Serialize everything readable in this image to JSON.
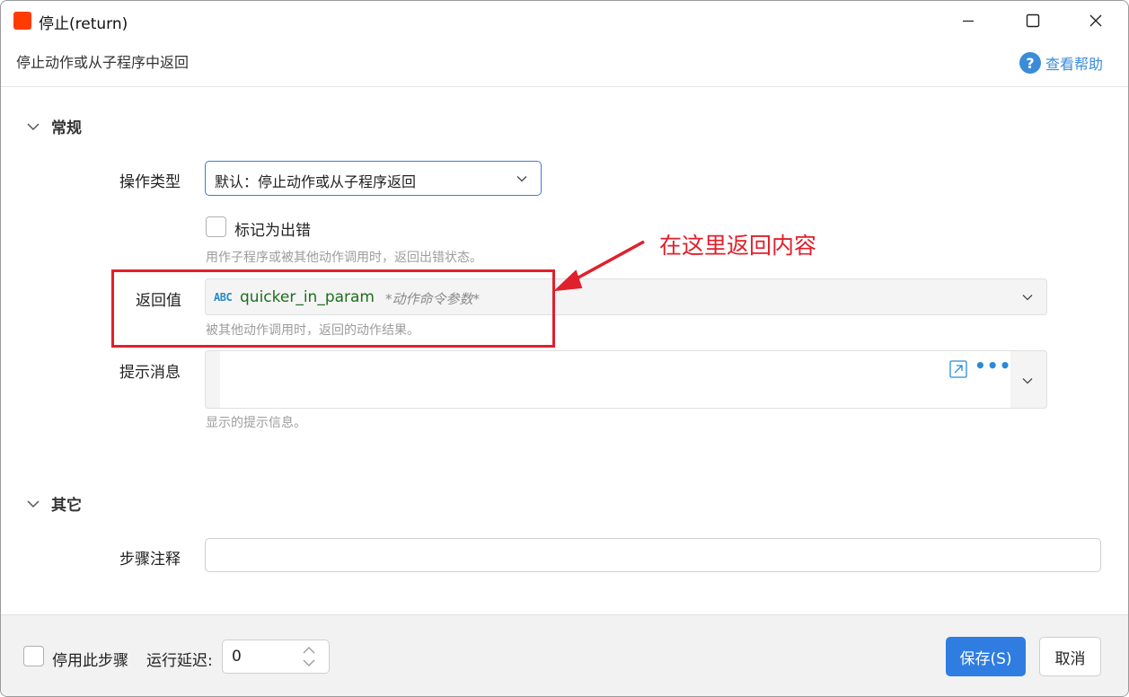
{
  "window": {
    "title": "停止(return)",
    "subtitle": "停止动作或从子程序中返回",
    "help_label": "查看帮助"
  },
  "colors": {
    "accent": "#2f7de1",
    "app_icon": "#ff3b00",
    "annotation": "#e0202c",
    "help": "#3b8cd8"
  },
  "general": {
    "section_title": "常规",
    "op_type": {
      "label": "操作类型",
      "value": "默认：停止动作或从子程序返回"
    },
    "mark_error": {
      "label": "标记为出错",
      "checked": false,
      "hint": "用作子程序或被其他动作调用时，返回出错状态。"
    },
    "return_value": {
      "label": "返回值",
      "type_badge": "ABC",
      "variable": "quicker_in_param",
      "variable_desc": "*动作命令参数*",
      "hint": "被其他动作调用时，返回的动作结果。"
    },
    "message": {
      "label": "提示消息",
      "value": "",
      "more_label": "•••",
      "hint": "显示的提示信息。"
    }
  },
  "annotation": {
    "text": "在这里返回内容"
  },
  "other": {
    "section_title": "其它",
    "step_note": {
      "label": "步骤注释",
      "value": ""
    }
  },
  "footer": {
    "disable_label": "停用此步骤",
    "disable_checked": false,
    "delay_label": "运行延迟:",
    "delay_value": "0",
    "save_label": "保存(S)",
    "cancel_label": "取消"
  }
}
